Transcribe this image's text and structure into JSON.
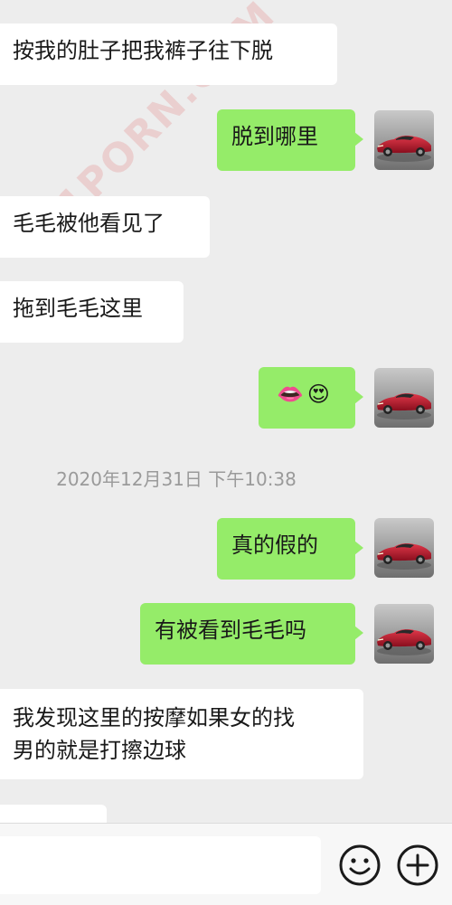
{
  "messages": [
    {
      "side": "left",
      "text": "按我的肚子把我裤子往下脱"
    },
    {
      "side": "right",
      "text": "脱到哪里"
    },
    {
      "side": "left",
      "text": "毛毛被他看见了"
    },
    {
      "side": "left",
      "text": "拖到毛毛这里"
    },
    {
      "side": "right",
      "emoji_1": "👄",
      "emoji_2": "😍"
    },
    {
      "side": "right",
      "text": "真的假的"
    },
    {
      "side": "right",
      "text": "有被看到毛毛吗"
    },
    {
      "side": "left",
      "line_1": "我发现这里的按摩如果女的找",
      "line_2": "男的就是打擦边球"
    }
  ],
  "timestamp": "2020年12月31日 下午10:38",
  "watermark": {
    "diagonal": "91PORN.COM",
    "top": "91P·1036e"
  },
  "input_bar": {
    "emoji_icon": "smiley-face-icon",
    "plus_icon": "plus-circle-icon"
  },
  "colors": {
    "background": "#ededed",
    "left_bubble": "#ffffff",
    "right_bubble": "#95ec69",
    "timestamp_text": "#9a9a9a"
  }
}
